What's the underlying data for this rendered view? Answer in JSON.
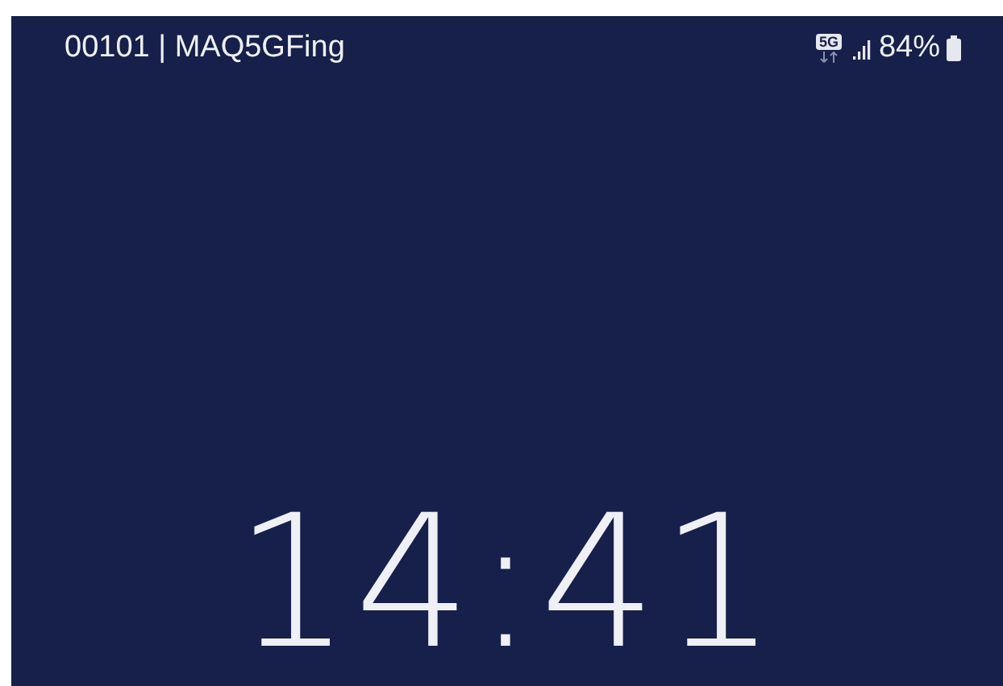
{
  "status_bar": {
    "carrier": "00101 | MAQ5GFing",
    "network_type": "5G",
    "battery_percent": "84%"
  },
  "lock_screen": {
    "clock": "14:41"
  }
}
